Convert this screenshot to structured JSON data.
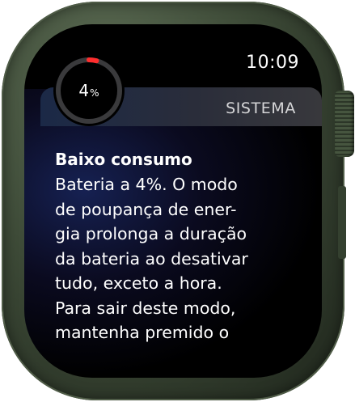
{
  "status": {
    "time": "10:09"
  },
  "battery": {
    "level_percent": 4,
    "value": "4",
    "unit": "%",
    "ring_colors": {
      "fill": "#ff2d2d",
      "track": "#3a3a3c"
    }
  },
  "notification": {
    "app_name": "SISTEMA",
    "title": "Baixo consumo",
    "body_lines": [
      "Bateria a 4%. O modo",
      "de poupança de ener-",
      "gia prolonga a duração",
      "da bateria ao desativar",
      "tudo, exceto a hora.",
      "Para sair deste modo,",
      "mantenha premido o"
    ]
  }
}
